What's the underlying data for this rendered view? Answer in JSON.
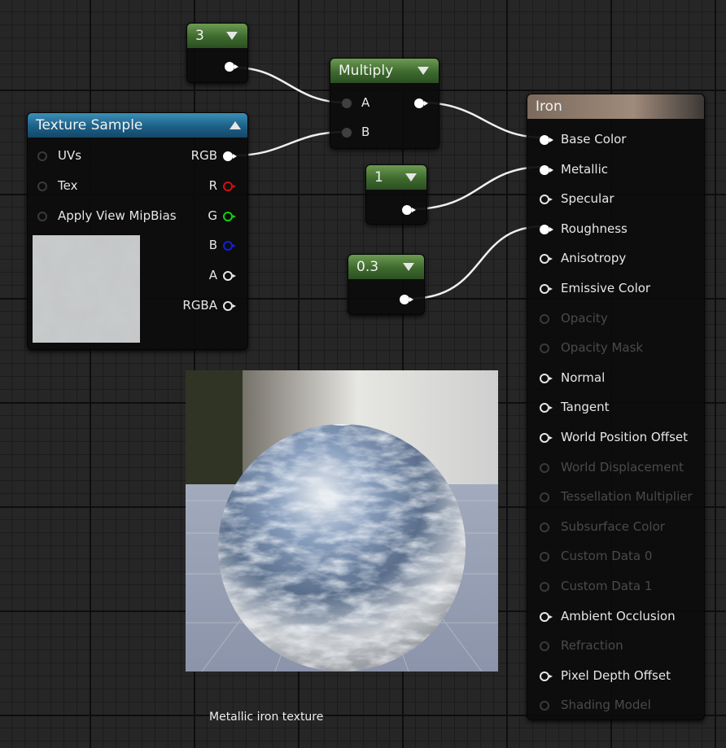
{
  "constant_3": {
    "value": "3"
  },
  "constant_1": {
    "value": "1"
  },
  "constant_03": {
    "value": "0.3"
  },
  "multiply": {
    "title": "Multiply",
    "inputs": [
      "A",
      "B"
    ]
  },
  "texture_sample": {
    "title": "Texture Sample",
    "inputs": [
      "UVs",
      "Tex",
      "Apply View MipBias"
    ],
    "outputs": [
      "RGB",
      "R",
      "G",
      "B",
      "A",
      "RGBA"
    ]
  },
  "material": {
    "title": "Iron",
    "pins": [
      {
        "label": "Base Color",
        "state": "connected"
      },
      {
        "label": "Metallic",
        "state": "connected"
      },
      {
        "label": "Specular",
        "state": "enabled"
      },
      {
        "label": "Roughness",
        "state": "connected"
      },
      {
        "label": "Anisotropy",
        "state": "enabled"
      },
      {
        "label": "Emissive Color",
        "state": "enabled"
      },
      {
        "label": "Opacity",
        "state": "disabled"
      },
      {
        "label": "Opacity Mask",
        "state": "disabled"
      },
      {
        "label": "Normal",
        "state": "enabled"
      },
      {
        "label": "Tangent",
        "state": "enabled"
      },
      {
        "label": "World Position Offset",
        "state": "enabled"
      },
      {
        "label": "World Displacement",
        "state": "disabled"
      },
      {
        "label": "Tessellation Multiplier",
        "state": "disabled"
      },
      {
        "label": "Subsurface Color",
        "state": "disabled"
      },
      {
        "label": "Custom Data 0",
        "state": "disabled"
      },
      {
        "label": "Custom Data 1",
        "state": "disabled"
      },
      {
        "label": "Ambient Occlusion",
        "state": "enabled"
      },
      {
        "label": "Refraction",
        "state": "disabled"
      },
      {
        "label": "Pixel Depth Offset",
        "state": "enabled"
      },
      {
        "label": "Shading Model",
        "state": "disabled"
      }
    ]
  },
  "preview": {
    "caption": "Metallic iron texture"
  },
  "colors": {
    "constant_header": "#4f7f3a",
    "texture_header": "#1d6088",
    "material_header": "#9a8472"
  }
}
